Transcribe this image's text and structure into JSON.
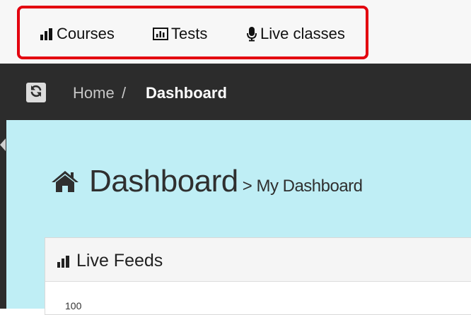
{
  "topnav": {
    "items": [
      {
        "label": "Courses",
        "icon": "bar-chart-icon"
      },
      {
        "label": "Tests",
        "icon": "chart-box-icon"
      },
      {
        "label": "Live classes",
        "icon": "microphone-icon"
      }
    ],
    "highlight_color": "#e3000f"
  },
  "breadcrumb": {
    "home": "Home",
    "separator": "/",
    "current": "Dashboard",
    "refresh_icon": "refresh-icon"
  },
  "page": {
    "title": "Dashboard",
    "subtitle": "> My Dashboard",
    "icon": "home-icon"
  },
  "panel": {
    "title": "Live Feeds",
    "icon": "bar-chart-icon",
    "axis_tick": "100"
  },
  "colors": {
    "frame": "#2c2c2c",
    "content_bg": "#bfeef5",
    "accent_red": "#e3000f"
  }
}
